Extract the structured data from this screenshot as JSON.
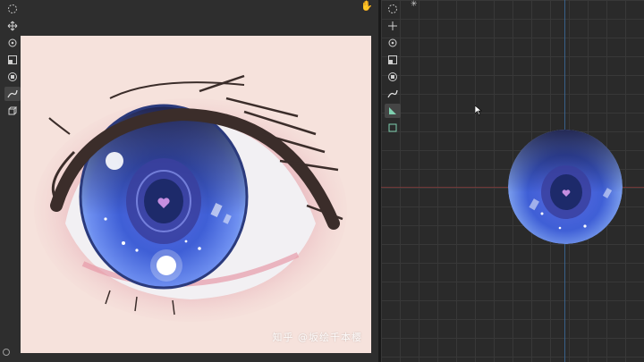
{
  "left_viewport": {
    "toolbar": [
      "target-icon",
      "move-icon",
      "rotate-icon",
      "scale-icon",
      "transform-icon",
      "brush-icon",
      "box-icon"
    ],
    "active_tool": "brush-icon",
    "watermark": "知乎 @坂绘千本樱"
  },
  "right_viewport": {
    "toolbar": [
      "target-icon",
      "move-icon",
      "rotate-icon",
      "scale-icon",
      "transform-icon",
      "brush-icon",
      "ruler-icon",
      "box-icon"
    ],
    "active_tool": "ruler-icon"
  },
  "colors": {
    "canvas_bg": "#f6e2dc",
    "iris_blue": "#3f5fd6",
    "pupil": "#1d2a6a",
    "axis_x": "#8a3b3b",
    "axis_y": "#3b6a9a"
  }
}
